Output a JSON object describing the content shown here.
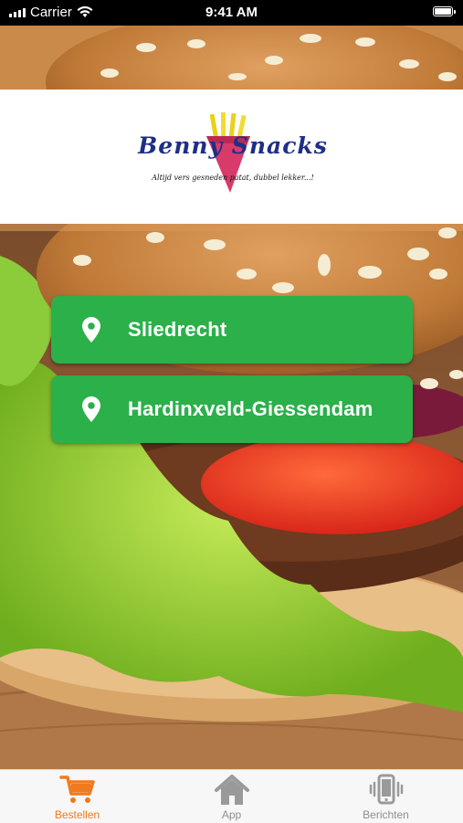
{
  "status_bar": {
    "carrier": "Carrier",
    "time": "9:41 AM"
  },
  "logo": {
    "name": "Benny Snacks",
    "tagline": "Altijd vers gesneden patat, dubbel lekker...!"
  },
  "locations": [
    {
      "label": "Sliedrecht"
    },
    {
      "label": "Hardinxveld-Giessendam"
    }
  ],
  "tab_bar": {
    "active_tab": "Bestellen",
    "accent_color": "#f07a1e",
    "tabs": [
      {
        "label": "Bestellen",
        "icon": "cart-icon"
      },
      {
        "label": "App",
        "icon": "home-icon"
      },
      {
        "label": "Berichten",
        "icon": "phone-vibrate-icon"
      }
    ]
  },
  "colors": {
    "location_button": "#2bb04a",
    "logo_text": "#1f2f86"
  }
}
